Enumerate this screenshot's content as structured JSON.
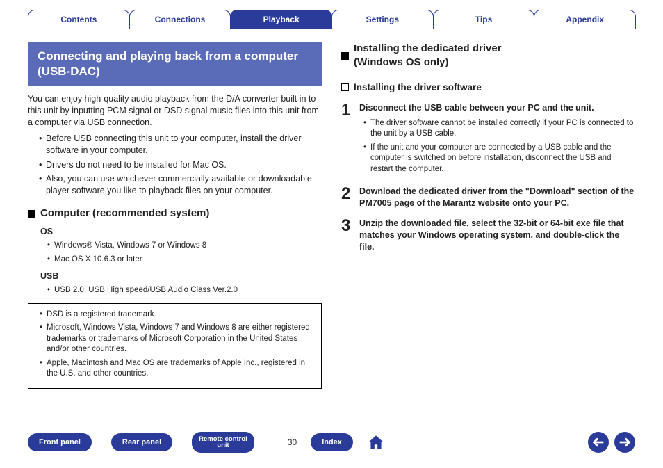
{
  "tabs": {
    "contents": "Contents",
    "connections": "Connections",
    "playback": "Playback",
    "settings": "Settings",
    "tips": "Tips",
    "appendix": "Appendix"
  },
  "left": {
    "title": "Connecting and playing back from a computer (USB-DAC)",
    "intro": "You can enjoy high-quality audio playback from the D/A converter built in to this unit by inputting PCM signal or DSD signal music files into this unit from a computer via USB connection.",
    "bullets": {
      "b1": "Before USB connecting this unit to your computer, install the driver software in your computer.",
      "b2": "Drivers do not need to be installed for Mac OS.",
      "b3": "Also, you can use whichever commercially available or downloadable player software you like to playback files on your computer."
    },
    "rec_heading": "Computer (recommended system)",
    "os_label": "OS",
    "os_items": {
      "o1": "Windows® Vista, Windows 7 or Windows 8",
      "o2": "Mac OS X 10.6.3 or later"
    },
    "usb_label": "USB",
    "usb_items": {
      "u1": "USB 2.0: USB High speed/USB Audio Class Ver.2.0"
    },
    "notes": {
      "n1": "DSD is a registered trademark.",
      "n2": "Microsoft, Windows Vista, Windows 7 and Windows 8 are either registered trademarks or trademarks of Microsoft Corporation in the United States and/or other countries.",
      "n3": "Apple, Macintosh and Mac OS are trademarks of Apple Inc., registered in the U.S. and other countries."
    }
  },
  "right": {
    "heading1a": "Installing the dedicated driver",
    "heading1b": "(Windows OS only)",
    "heading2": "Installing the driver software",
    "steps": {
      "s1": {
        "num": "1",
        "text": "Disconnect the USB cable between your PC and the unit.",
        "sub": {
          "a": "The driver software cannot be installed correctly if your PC is connected to the unit by a USB cable.",
          "b": "If the unit and your computer are connected by a USB cable and the computer is switched on before installation, disconnect the USB and restart the computer."
        }
      },
      "s2": {
        "num": "2",
        "text": "Download the dedicated driver from the \"Download\" section of the PM7005 page of the Marantz website onto your PC."
      },
      "s3": {
        "num": "3",
        "text": "Unzip the downloaded file, select the 32-bit or 64-bit exe file that matches your Windows operating system, and double-click the file."
      }
    }
  },
  "footer": {
    "front": "Front panel",
    "rear": "Rear panel",
    "remote1": "Remote control",
    "remote2": "unit",
    "page": "30",
    "index": "Index"
  }
}
